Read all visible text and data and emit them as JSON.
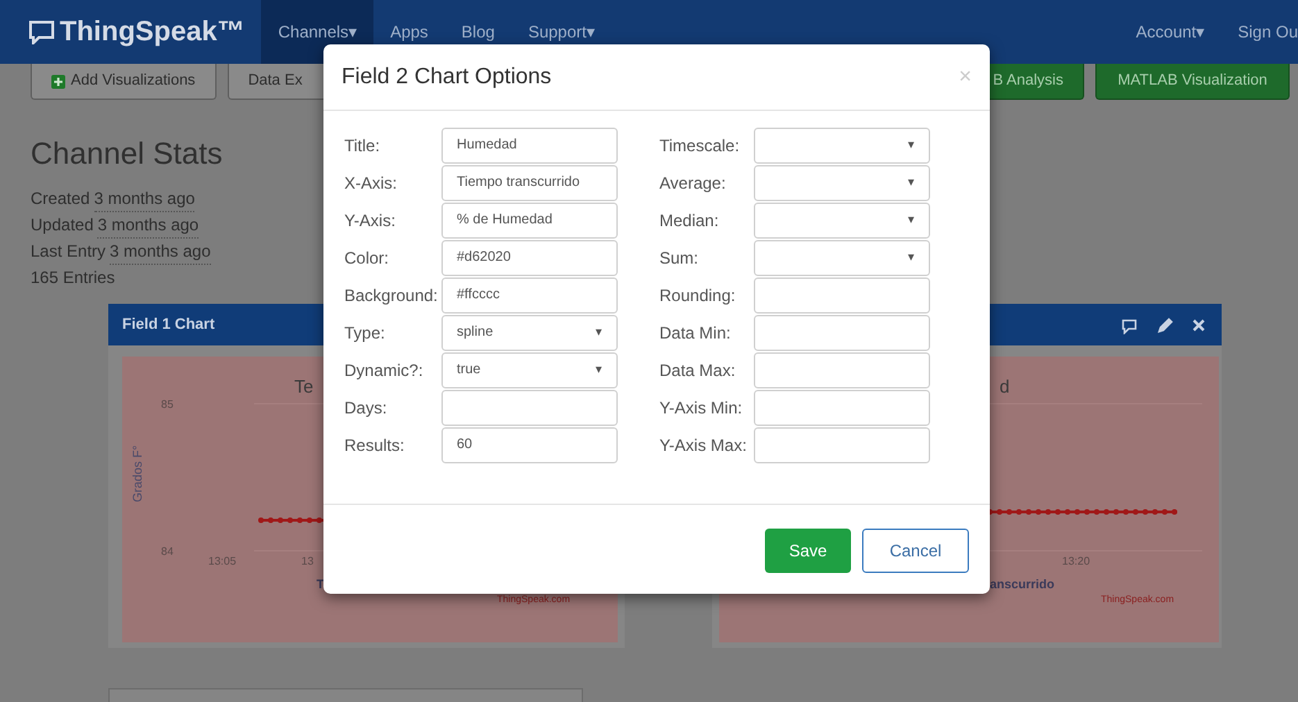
{
  "navbar": {
    "brand": "ThingSpeak™",
    "items": [
      {
        "label": "Channels",
        "caret": "▾",
        "selected": true
      },
      {
        "label": "Apps",
        "selected": false
      },
      {
        "label": "Blog",
        "selected": false
      },
      {
        "label": "Support",
        "caret": "▾",
        "selected": false
      }
    ],
    "right_items": [
      {
        "label": "Account",
        "caret": "▾"
      },
      {
        "label": "Sign Ou"
      }
    ]
  },
  "toolbar": [
    {
      "label": "Add Visualizations",
      "kind": "add"
    },
    {
      "label": "Data Ex",
      "kind": "plain"
    },
    {
      "label": "B Analysis",
      "kind": "green"
    },
    {
      "label": "MATLAB Visualization",
      "kind": "green"
    }
  ],
  "channel_stats": {
    "title": "Channel Stats",
    "rows": [
      {
        "label": "Created",
        "value": "3 months ago"
      },
      {
        "label": "Updated",
        "value": "3 months ago"
      },
      {
        "label": "Last Entry",
        "value": "3 months ago"
      }
    ],
    "entries": "165 Entries"
  },
  "charts": [
    {
      "title": "Field 1 Chart",
      "chart_title": "Te",
      "ylabel": "Grados F°",
      "yticks": [
        "85",
        "84"
      ],
      "xticks": [
        "13:05",
        "13"
      ],
      "xlabel": "T",
      "credit": "ThingSpeak.com"
    },
    {
      "chart_title": "d",
      "xticks": [
        "13:20"
      ],
      "xlabel": "anscurrido",
      "credit": "ThingSpeak.com"
    }
  ],
  "modal": {
    "title": "Field 2 Chart Options",
    "close": "×",
    "left_fields": [
      {
        "label": "Title:",
        "kind": "text",
        "value": "Humedad"
      },
      {
        "label": "X-Axis:",
        "kind": "text",
        "value": "Tiempo transcurrido"
      },
      {
        "label": "Y-Axis:",
        "kind": "text",
        "value": "% de Humedad"
      },
      {
        "label": "Color:",
        "kind": "text",
        "value": "#d62020"
      },
      {
        "label": "Background:",
        "kind": "text",
        "value": "#ffcccc"
      },
      {
        "label": "Type:",
        "kind": "select",
        "value": "spline",
        "caret": "▾"
      },
      {
        "label": "Dynamic?:",
        "kind": "select",
        "value": "true",
        "caret": "▾"
      },
      {
        "label": "Days:",
        "kind": "text"
      },
      {
        "label": "Results:",
        "kind": "text",
        "value": "60"
      }
    ],
    "right_fields": [
      {
        "label": "Timescale:",
        "kind": "select",
        "caret": "▾"
      },
      {
        "label": "Average:",
        "kind": "select",
        "caret": "▾"
      },
      {
        "label": "Median:",
        "kind": "select",
        "caret": "▾"
      },
      {
        "label": "Sum:",
        "kind": "select",
        "caret": "▾"
      },
      {
        "label": "Rounding:",
        "kind": "text"
      },
      {
        "label": "Data Min:",
        "kind": "text"
      },
      {
        "label": "Data Max:",
        "kind": "text"
      },
      {
        "label": "Y-Axis Min:",
        "kind": "text"
      },
      {
        "label": "Y-Axis Max:",
        "kind": "text"
      }
    ],
    "buttons": [
      {
        "label": "Save",
        "kind": "primary"
      },
      {
        "label": "Cancel",
        "kind": "secondary"
      }
    ]
  }
}
